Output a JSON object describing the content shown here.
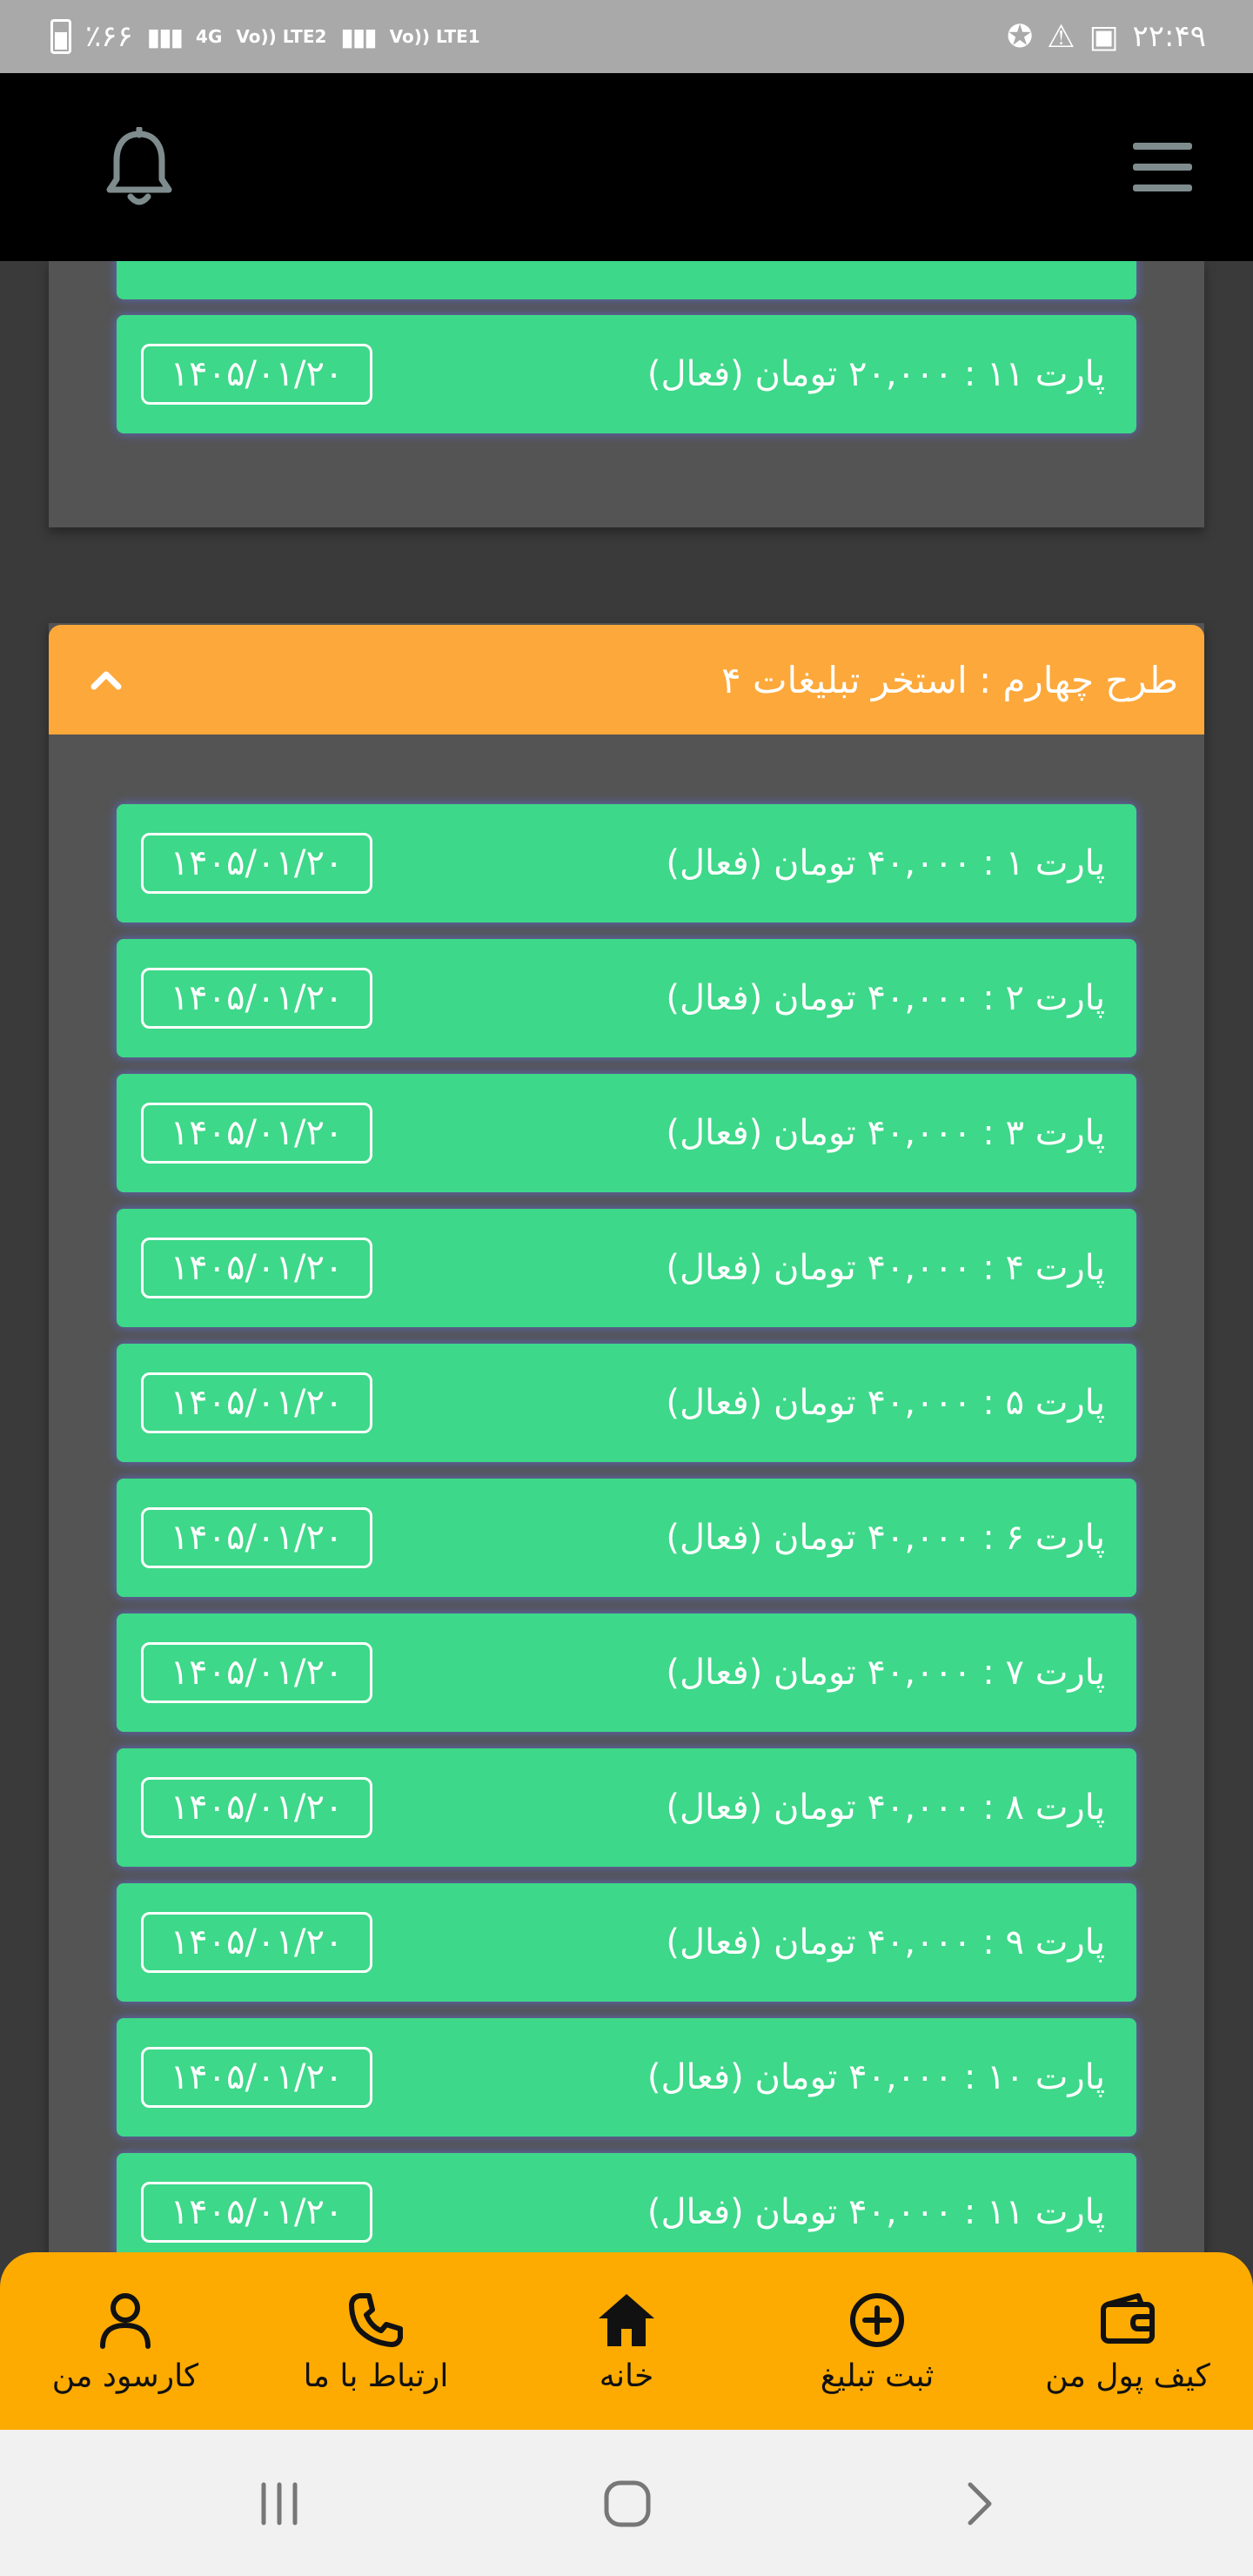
{
  "status_bar": {
    "battery": "٪۶۶",
    "network_4g": "4G",
    "lte2": "Vo)) LTE2",
    "lte1": "Vo)) LTE1",
    "time": "۲۲:۴۹"
  },
  "plan_top_rows": [
    {
      "label": "پارت ۱۱ : ۲۰,۰۰۰ تومان (فعال)",
      "date": "۱۴۰۵/۰۱/۲۰"
    }
  ],
  "plan4": {
    "title": "طرح چهارم : استخر تبلیغات ۴",
    "rows": [
      {
        "label": "پارت ۱ : ۴۰,۰۰۰ تومان (فعال)",
        "date": "۱۴۰۵/۰۱/۲۰"
      },
      {
        "label": "پارت ۲ : ۴۰,۰۰۰ تومان (فعال)",
        "date": "۱۴۰۵/۰۱/۲۰"
      },
      {
        "label": "پارت ۳ : ۴۰,۰۰۰ تومان (فعال)",
        "date": "۱۴۰۵/۰۱/۲۰"
      },
      {
        "label": "پارت ۴ : ۴۰,۰۰۰ تومان (فعال)",
        "date": "۱۴۰۵/۰۱/۲۰"
      },
      {
        "label": "پارت ۵ : ۴۰,۰۰۰ تومان (فعال)",
        "date": "۱۴۰۵/۰۱/۲۰"
      },
      {
        "label": "پارت ۶ : ۴۰,۰۰۰ تومان (فعال)",
        "date": "۱۴۰۵/۰۱/۲۰"
      },
      {
        "label": "پارت ۷ : ۴۰,۰۰۰ تومان (فعال)",
        "date": "۱۴۰۵/۰۱/۲۰"
      },
      {
        "label": "پارت ۸ : ۴۰,۰۰۰ تومان (فعال)",
        "date": "۱۴۰۵/۰۱/۲۰"
      },
      {
        "label": "پارت ۹ : ۴۰,۰۰۰ تومان (فعال)",
        "date": "۱۴۰۵/۰۱/۲۰"
      },
      {
        "label": "پارت ۱۰ : ۴۰,۰۰۰ تومان (فعال)",
        "date": "۱۴۰۵/۰۱/۲۰"
      },
      {
        "label": "پارت ۱۱ : ۴۰,۰۰۰ تومان (فعال)",
        "date": "۱۴۰۵/۰۱/۲۰"
      }
    ]
  },
  "bottom_nav": {
    "wallet": "کیف پول من",
    "submit_ad": "ثبت تبلیغ",
    "home": "خانه",
    "contact": "ارتباط با ما",
    "earnings": "کارسود من"
  },
  "colors": {
    "header": "#000000",
    "background": "#3a3a3a",
    "panel": "#545454",
    "row": "#3dd889",
    "plan_header": "#fda83a",
    "bottom_nav": "#fdab00"
  },
  "icons": {
    "header_left": "bell-icon",
    "header_right": "hamburger-menu-icon",
    "plan_toggle": "chevron-up-icon",
    "nav": [
      "wallet-icon",
      "plus-circle-icon",
      "home-icon",
      "phone-icon",
      "user-icon"
    ],
    "system": [
      "recents-icon",
      "home-circle-icon",
      "back-chevron-icon"
    ]
  }
}
